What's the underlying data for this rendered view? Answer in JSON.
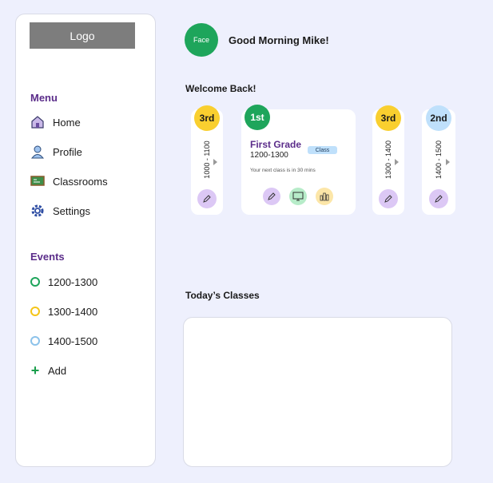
{
  "logo": "Logo",
  "menu": {
    "title": "Menu",
    "items": [
      {
        "label": "Home",
        "icon": "house-icon"
      },
      {
        "label": "Profile",
        "icon": "user-icon"
      },
      {
        "label": "Classrooms",
        "icon": "chalkboard-icon"
      },
      {
        "label": "Settings",
        "icon": "gear-icon"
      }
    ]
  },
  "events": {
    "title": "Events",
    "items": [
      {
        "label": "1200-1300",
        "color": "#1ea55b"
      },
      {
        "label": "1300-1400",
        "color": "#f5c518"
      },
      {
        "label": "1400-1500",
        "color": "#8cc2ea"
      }
    ],
    "add_label": "Add"
  },
  "header": {
    "avatar": "Face",
    "greeting": "Good Morning Mike!"
  },
  "welcome": "Welcome Back!",
  "cards": [
    {
      "grade": "3rd",
      "time": "1000 - 1100",
      "color": "#f9cf2f"
    },
    {
      "grade": "1st",
      "title": "First Grade",
      "time": "1200-1300",
      "tag": "Class",
      "note": "Your next class is in 30 mins",
      "color": "#1ea55b"
    },
    {
      "grade": "3rd",
      "time": "1300 - 1400",
      "color": "#f9cf2f"
    },
    {
      "grade": "2nd",
      "time": "1400 - 1500",
      "color": "#bfe0fb"
    }
  ],
  "today": "Today’s Classes"
}
